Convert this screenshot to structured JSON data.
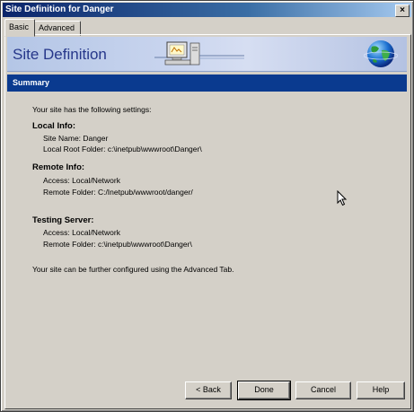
{
  "window": {
    "title": "Site Definition for Danger",
    "close_glyph": "×"
  },
  "tabs": [
    {
      "label": "Basic",
      "active": true
    },
    {
      "label": "Advanced",
      "active": false
    }
  ],
  "banner": {
    "title": "Site Definition"
  },
  "section": {
    "title": "Summary"
  },
  "summary": {
    "intro": "Your site has the following settings:",
    "local": {
      "heading": "Local Info:",
      "site_name": "Site Name: Danger",
      "root_folder": "Local Root Folder: c:\\inetpub\\wwwroot\\Danger\\"
    },
    "remote": {
      "heading": "Remote Info:",
      "access": "Access: Local/Network",
      "folder": "Remote Folder: C:/Inetpub/wwwroot/danger/"
    },
    "testing": {
      "heading": "Testing Server:",
      "access": "Access: Local/Network",
      "folder": "Remote Folder: c:\\inetpub\\wwwroot\\Danger\\"
    },
    "footer": "Your site can be further configured using the Advanced Tab."
  },
  "buttons": {
    "back": "< Back",
    "done": "Done",
    "cancel": "Cancel",
    "help": "Help"
  },
  "colors": {
    "titlebar": "#0a246a",
    "section_bar": "#0a3a8f",
    "banner_text": "#26378a",
    "face": "#d4d0c8"
  },
  "icons": [
    "computer-icon",
    "globe-icon",
    "mouse-cursor-icon"
  ]
}
